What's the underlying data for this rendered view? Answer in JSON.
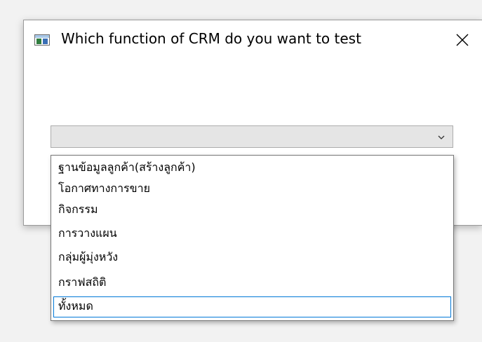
{
  "dialog": {
    "title": "Which function of CRM do you want to test",
    "close_glyph": "close-icon"
  },
  "combo": {
    "value": "",
    "arrow_icon": "chevron-down-icon"
  },
  "dropdown": {
    "options": [
      "ฐานข้อมูลลูกค้า(สร้างลูกค้า)",
      "โอกาศทางการขาย",
      "กิจกรรม",
      "การวางแผน",
      "กลุ่มผู้มุ่งหวัง",
      "กราฟสถิติ",
      "ทั้งหมด"
    ],
    "focused_index": 6
  },
  "colors": {
    "focus_border": "#0078d7",
    "combo_bg": "#e5e5e5",
    "page_bg": "#f2f2f2"
  }
}
